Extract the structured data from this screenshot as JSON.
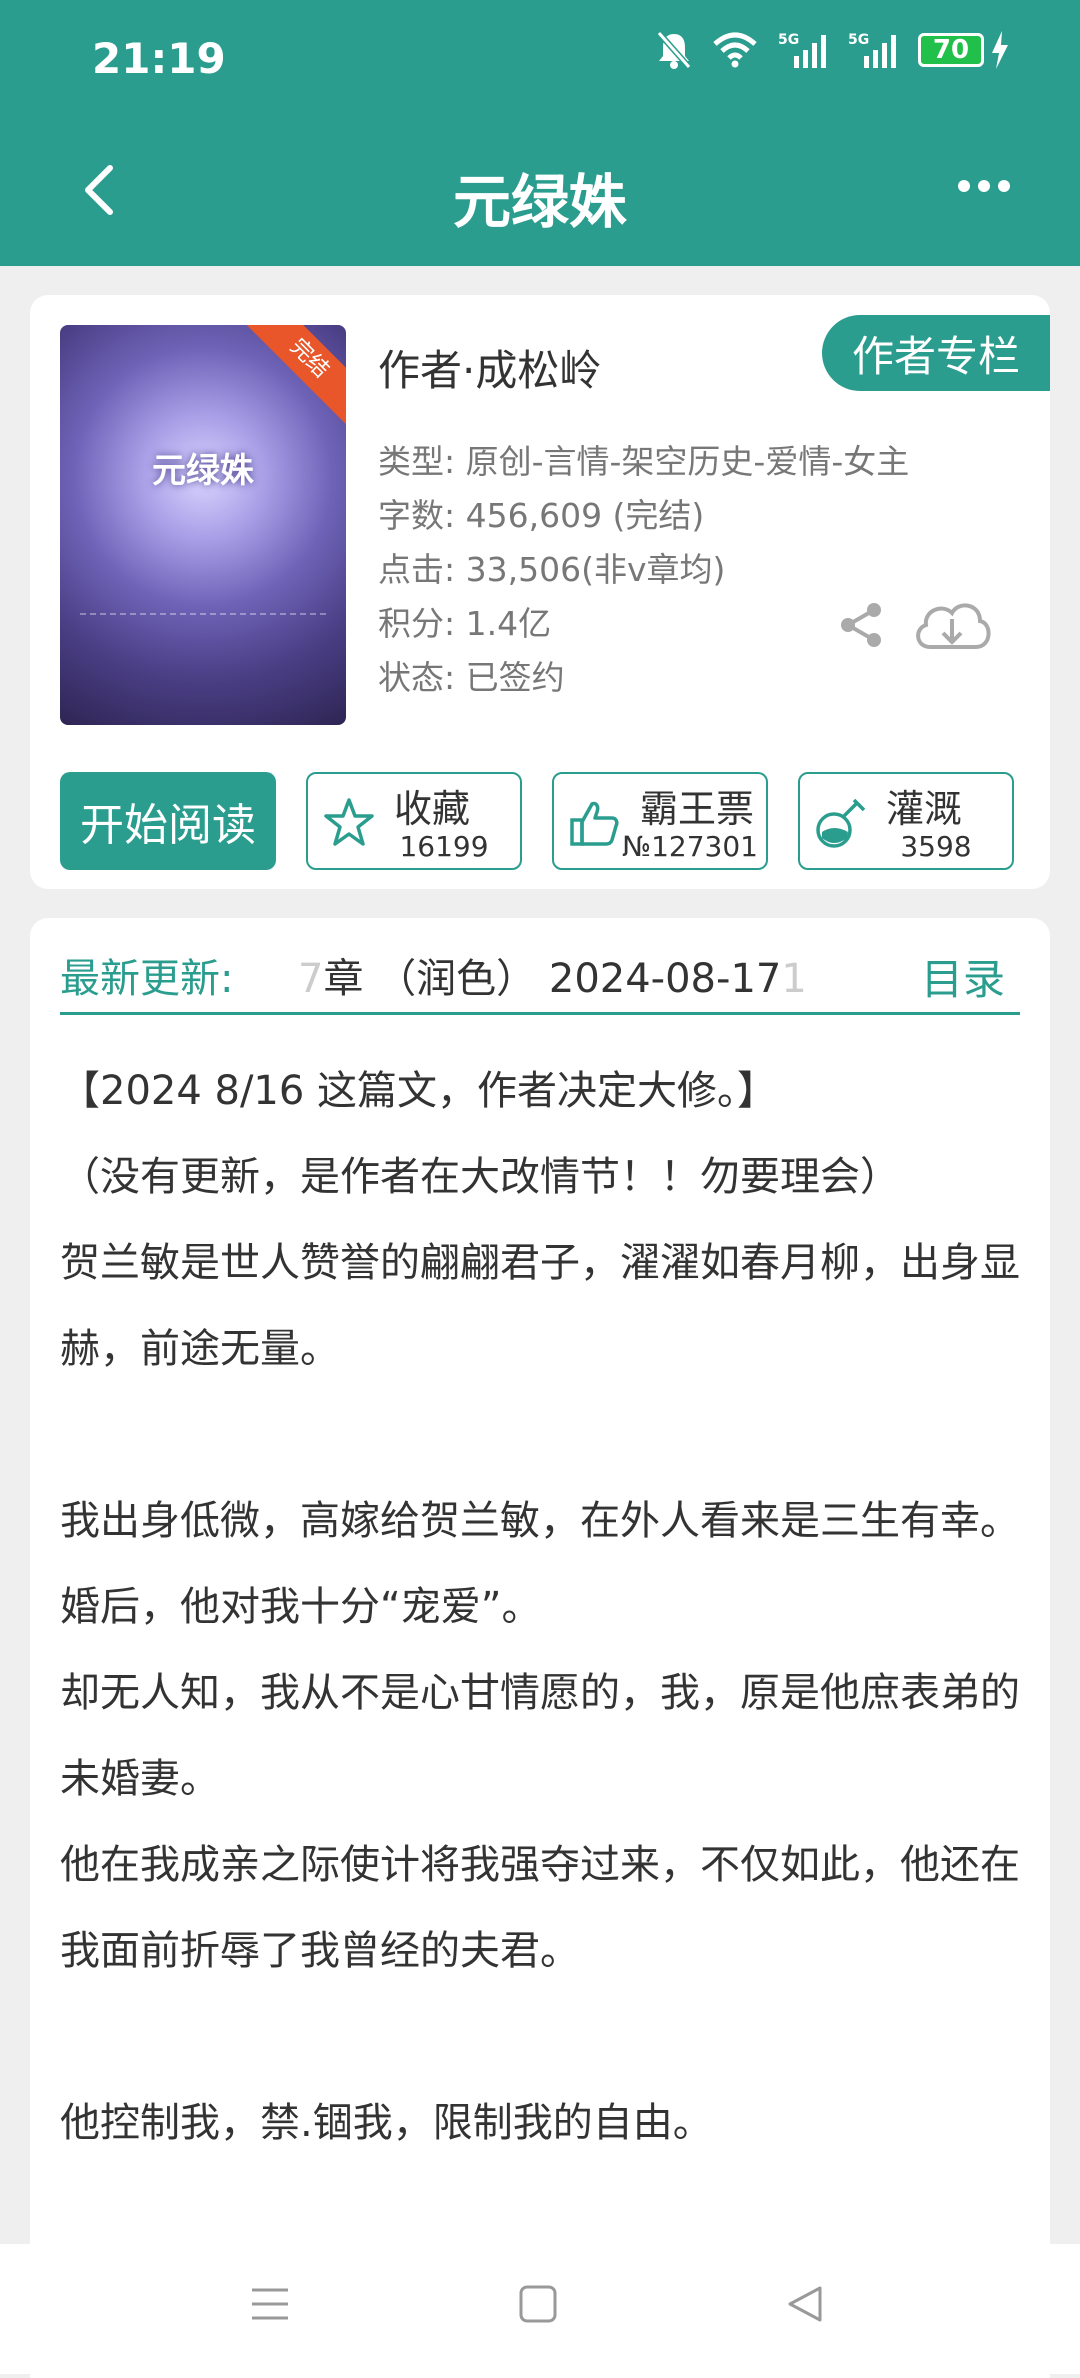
{
  "status_bar": {
    "time": "21:19",
    "battery": "70",
    "signal1": "5G",
    "signal2": "5G"
  },
  "header": {
    "title": "元绿姝"
  },
  "book": {
    "cover_title": "元绿姝",
    "cover_badge": "完结",
    "author": "作者·成松岭",
    "author_column_button": "作者专栏",
    "meta": {
      "type": "类型: 原创-言情-架空历史-爱情-女主",
      "words": "字数: 456,609 (完结)",
      "clicks": "点击: 33,506(非v章均)",
      "points": "积分: 1.4亿",
      "status": "状态: 已签约"
    }
  },
  "actions": {
    "start_read": "开始阅读",
    "collect": {
      "label": "收藏",
      "count": "16199"
    },
    "vote": {
      "label": "霸王票",
      "count": "№127301"
    },
    "water": {
      "label": "灌溉",
      "count": "3598"
    }
  },
  "latest": {
    "label": "最新更新:",
    "faded_prefix": "7",
    "text": "章 （润色） 2024-08-17",
    "faded_suffix": "1",
    "toc": "目录"
  },
  "intro": [
    "【2024 8/16  这篇文，作者决定大修。】",
    "（没有更新，是作者在大改情节！！勿要理会）",
    " 贺兰敏是世人赞誉的翩翩君子，濯濯如春月柳，出身显赫，前途无量。",
    "",
    " 我出身低微，高嫁给贺兰敏，在外人看来是三生有幸。",
    " 婚后，他对我十分“宠爱”。",
    " 却无人知，我从不是心甘情愿的，我，原是他庶表弟的未婚妻。",
    " 他在我成亲之际使计将我强夺过来，不仅如此，他还在我面前折辱了我曾经的夫君。",
    "",
    " 他控制我，禁.锢我，限制我的自由。"
  ]
}
